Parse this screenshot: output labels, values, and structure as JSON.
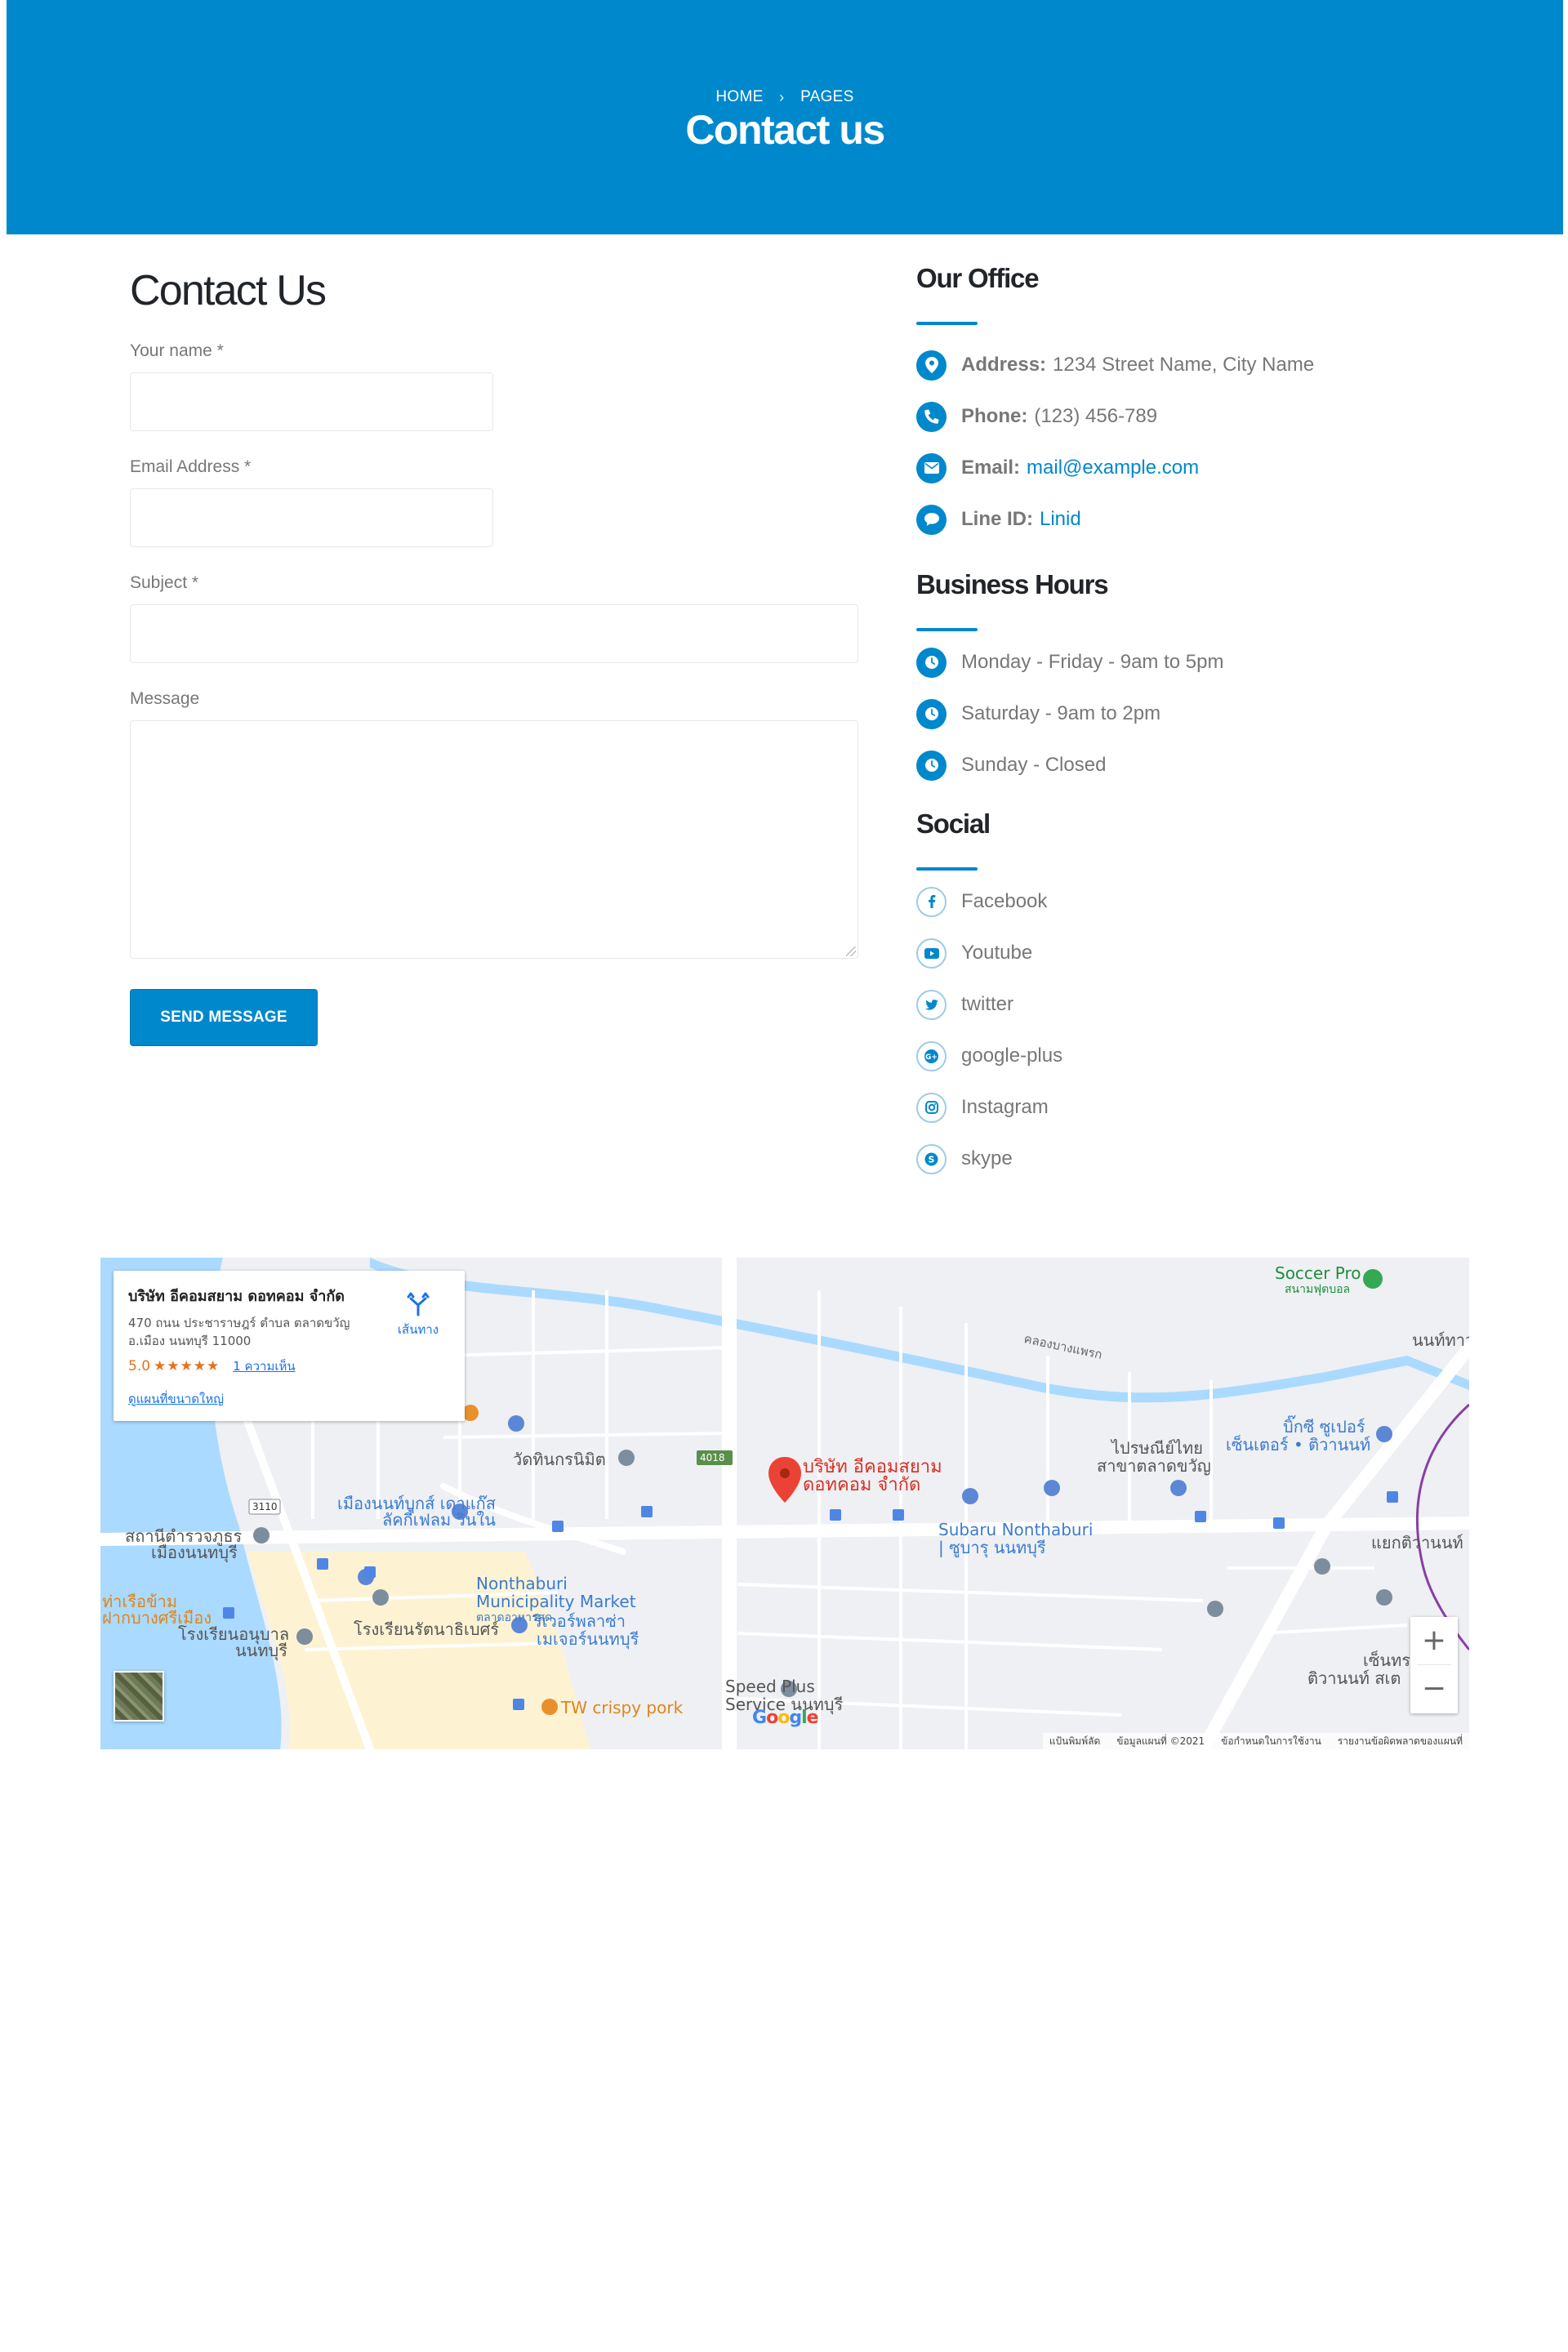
{
  "header": {
    "breadcrumb": {
      "home": "HOME",
      "pages": "PAGES"
    },
    "title": "Contact us",
    "background_color": "#0088cc"
  },
  "contact_form": {
    "heading": "Contact Us",
    "name_label": "Your name *",
    "email_label": "Email Address *",
    "subject_label": "Subject *",
    "message_label": "Message",
    "name_value": "",
    "email_value": "",
    "subject_value": "",
    "message_value": "",
    "submit_label": "SEND MESSAGE"
  },
  "office": {
    "heading": "Our Office",
    "address_label": "Address:",
    "address_value": "1234 Street Name, City Name",
    "phone_label": "Phone:",
    "phone_value": "(123) 456-789",
    "email_label": "Email:",
    "email_value": "mail@example.com",
    "line_label": "Line ID:",
    "line_value": "Linid"
  },
  "hours": {
    "heading": "Business Hours",
    "items": [
      "Monday - Friday - 9am to 5pm",
      "Saturday - 9am to 2pm",
      "Sunday - Closed"
    ]
  },
  "social": {
    "heading": "Social",
    "items": [
      "Facebook",
      "Youtube",
      "twitter",
      "google-plus",
      "Instagram",
      "skype"
    ]
  },
  "map": {
    "card": {
      "place_name": "บริษัท อีคอมสยาม ดอทคอม จำกัด",
      "address": "470 ถนน ประชาราษฎร์ ตำบล ตลาดขวัญ อ.เมือง นนทบุรี 11000",
      "rating": "5.0",
      "stars": "★★★★★",
      "reviews": "1 ความเห็น",
      "directions": "เส้นทาง",
      "larger_map": "ดูแผนที่ขนาดใหญ่"
    },
    "marker_label_1": "บริษัท อีคอมสยาม",
    "marker_label_2": "ดอทคอม จำกัด",
    "labels": {
      "soccer": "Soccer Pro",
      "soccer_th": "สนามฟุตบอล",
      "nonthaburi_market": "Nonthaburi",
      "nonthaburi_market_2": "Municipality Market",
      "market_th": "ตลาดอาหารสด",
      "subaru": "Subaru Nonthaburi",
      "subaru_th": "| ซูบารุ นนทบุรี",
      "tw_crispy": "TW crispy pork",
      "speed_plus": "Speed Plus",
      "speed_plus_2": "Service นนทบุรี",
      "big_c": "บิ๊กซี ซูเปอร์",
      "big_c_2": "เซ็นเตอร์ • ติวานนท์",
      "post_office": "ไปรษณีย์ไทย",
      "post_office_2": "สาขาตลาดขวัญ",
      "temple": "วัดทินกรนิมิต",
      "mueang_nonthaburi": "เมืองนนท์บุกส์ เดาแก๊ส",
      "mueang_2": "ลัคกี้เฟลม วินใน",
      "police": "สถานีตำรวจภูธร",
      "police_2": "เมืองนนทบุรี",
      "ratanathibet": "โรงเรียนรัตนาธิเบศร์",
      "river_plaza": "ริเวอร์พลาซ่า",
      "river_plaza_2": "เมเจอร์นนทบุรี",
      "school": "โรงเรียนอนุบาล",
      "school_2": "นนทบุรี",
      "pier": "ท่าเรือข้าม",
      "pier_2": "ฝากบางศรีเมือง",
      "tiwanon_junction": "แยกติวานนท์",
      "tiwanon": "นนท์ทาว",
      "central": "เซ็นทร",
      "central_2": "ติวานนท์ สเต",
      "khlong": "คลองบางแพรก",
      "road_4018": "4018",
      "road_3110": "3110"
    },
    "zoom_in": "+",
    "zoom_out": "−",
    "footer": {
      "shortcuts": "แป้นพิมพ์ลัด",
      "map_data": "ข้อมูลแผนที่ ©2021",
      "terms": "ข้อกำหนดในการใช้งาน",
      "report": "รายงานข้อผิดพลาดของแผนที่"
    },
    "google": "Google"
  },
  "colors": {
    "accent": "#0088cc",
    "heading": "#212529",
    "text": "#777777"
  }
}
